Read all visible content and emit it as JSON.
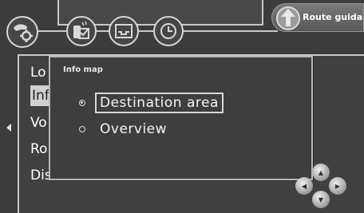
{
  "top_bar": {
    "route_guidance_label": "Route guidance"
  },
  "menu": {
    "items": [
      {
        "label": "Lo"
      },
      {
        "label": "Inf"
      },
      {
        "label": "Vo"
      },
      {
        "label": "Ro"
      },
      {
        "label": "Dis"
      }
    ]
  },
  "popup": {
    "title": "Info map",
    "options": [
      {
        "label": "Destination area",
        "checked": true
      },
      {
        "label": "Overview",
        "checked": false
      }
    ]
  },
  "icons": [
    "map-settings-icon",
    "phone-icon",
    "display-icon",
    "clock-icon",
    "route-arrow-icon",
    "left-arrow-icon",
    "joystick-icon"
  ]
}
